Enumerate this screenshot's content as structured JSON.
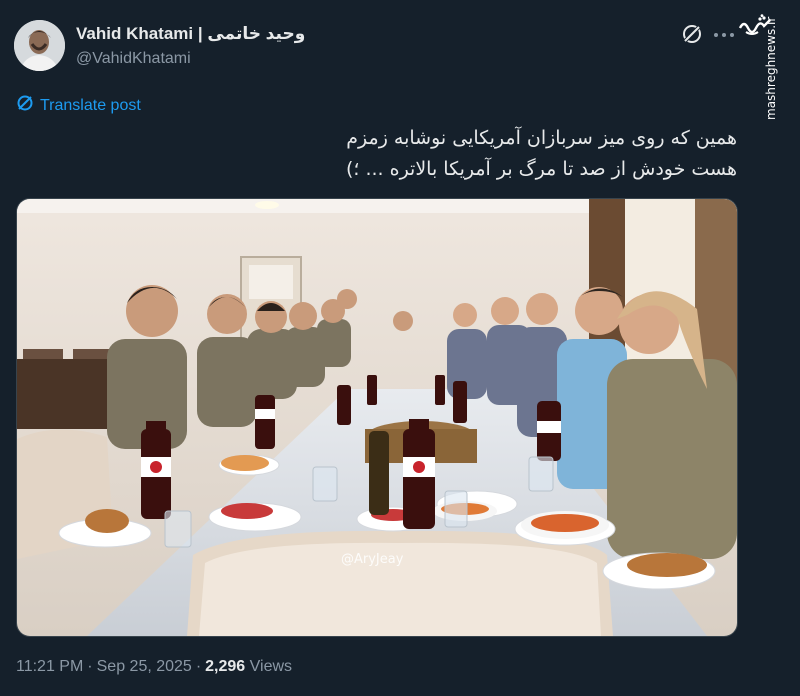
{
  "author": {
    "display_name": "Vahid Khatami | وحید خاتمی",
    "handle": "@VahidKhatami"
  },
  "watermark": {
    "logo_text": "مشرق",
    "site": "mashreghnews.ir"
  },
  "translate_label": "Translate post",
  "tweet": {
    "line1": "همین که روی میز سربازان آمریکایی نوشابه زمزم",
    "line2": "هست خودش از صد تا مرگ بر آمریکا بالاتره ... ؛)"
  },
  "media": {
    "photo_watermark": "@AryJeay"
  },
  "meta": {
    "time": "11:21 PM",
    "date": "Sep 25, 2025",
    "views_count": "2,296",
    "views_label": "Views"
  },
  "colors": {
    "background": "#15202b",
    "link": "#1d9bf0",
    "muted": "#8b98a5"
  },
  "icons": [
    "grok-icon",
    "more-icon",
    "translate-icon"
  ]
}
